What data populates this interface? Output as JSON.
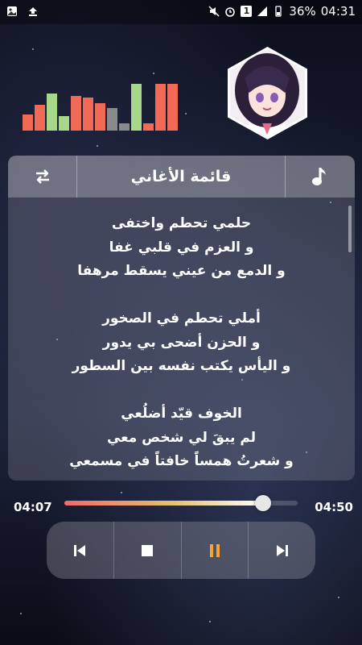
{
  "status_bar": {
    "battery": "36%",
    "time": "04:31",
    "sim": "1"
  },
  "colors": {
    "eq_red": "#f06a55",
    "eq_green": "#a7d88a",
    "eq_gray": "#8a8a8a",
    "pause_orange": "#f7a531",
    "accent": "#ffffff"
  },
  "equalizer": {
    "levels": [
      0.3,
      0.48,
      0.7,
      0.27,
      0.65,
      0.62,
      0.52,
      0.42,
      0.14,
      0.88,
      0.14,
      0.88,
      0.88
    ],
    "colors": [
      "red",
      "red",
      "green",
      "green",
      "red",
      "red",
      "red",
      "gray",
      "gray",
      "green",
      "red",
      "red",
      "red"
    ]
  },
  "playlist": {
    "title": "قائمة الأغاني",
    "left_icon": "repeat-icon",
    "right_icon": "music-note-icon"
  },
  "lyrics": {
    "lines": [
      "حلمي تحطم واختفى",
      "و العزم في قلبي غفا",
      "و الدمع من عيني يسقط مرهفا",
      "",
      "أملي تحطم في الصخور",
      "و الحزن أضحى بي يدور",
      "و اليأس يكتب نفسه بين السطور",
      "",
      "الخوف قيّد أضلُعي",
      "لم يبقَ لي شخص معي",
      "و شعرتُ همساً خافتاً في مسمعي"
    ]
  },
  "player": {
    "elapsed": "04:07",
    "total": "04:50",
    "progress": 0.852,
    "buttons": [
      "previous-icon",
      "stop-icon",
      "pause-icon",
      "next-icon"
    ]
  }
}
